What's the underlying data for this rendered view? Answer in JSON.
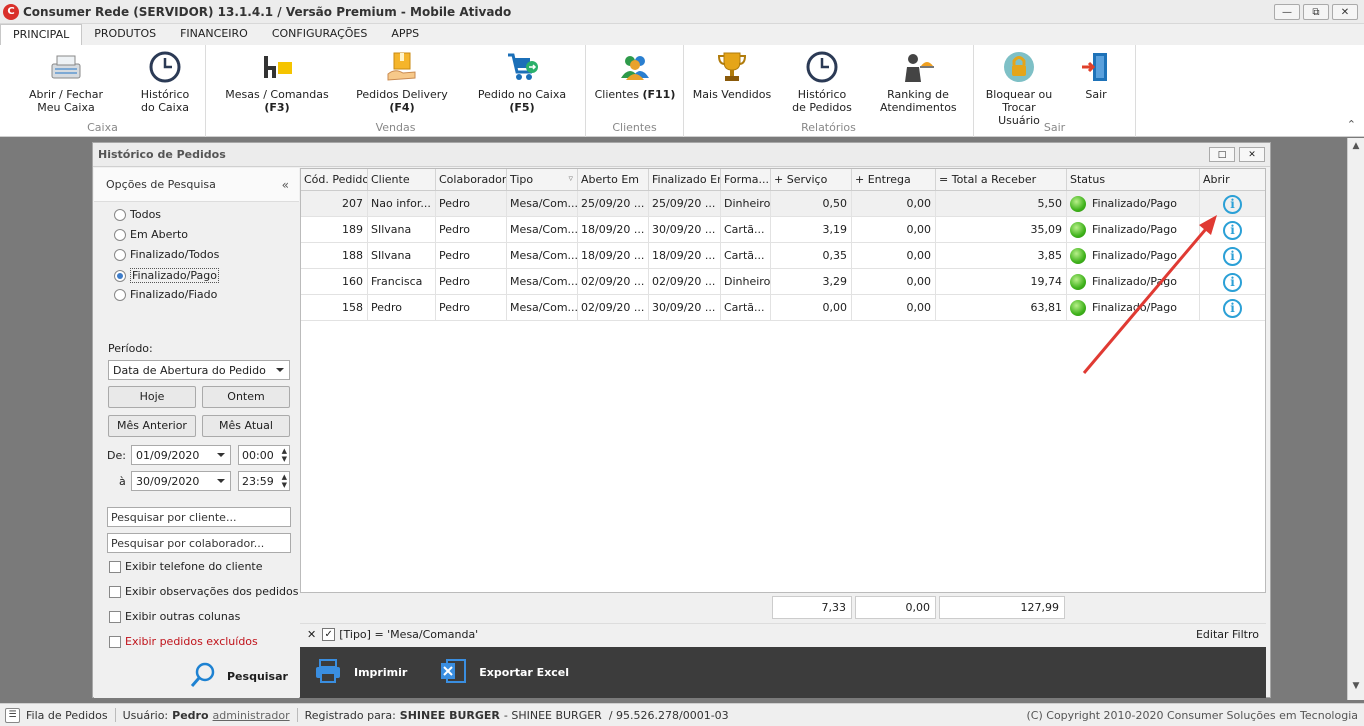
{
  "window": {
    "title": "Consumer Rede (SERVIDOR) 13.1.4.1 / Versão Premium - Mobile Ativado",
    "logo_icon": "consumer-logo-icon"
  },
  "menu_tabs": [
    "PRINCIPAL",
    "PRODUTOS",
    "FINANCEIRO",
    "CONFIGURAÇÕES",
    "APPS"
  ],
  "ribbon": {
    "groups": {
      "caixa": "Caixa",
      "vendas": "Vendas",
      "clientes": "Clientes",
      "relatorios": "Relatórios",
      "sair": "Sair"
    },
    "buttons": {
      "abrir_l1": "Abrir / Fechar",
      "abrir_l2": "Meu Caixa",
      "hist_caixa_l1": "Histórico",
      "hist_caixa_l2": "do Caixa",
      "mesas": "Mesas / Comandas",
      "mesas_key": "(F3)",
      "delivery": "Pedidos Delivery",
      "delivery_key": "(F4)",
      "pedido_caixa": "Pedido no Caixa",
      "pedido_caixa_key": "(F5)",
      "clientes": "Clientes",
      "clientes_key": "(F11)",
      "mais_vendidos": "Mais Vendidos",
      "hist_pedidos_l1": "Histórico",
      "hist_pedidos_l2": "de Pedidos",
      "ranking_l1": "Ranking de",
      "ranking_l2": "Atendimentos",
      "bloquear_l1": "Bloquear ou",
      "bloquear_l2": "Trocar Usuário",
      "sair": "Sair"
    }
  },
  "child_window": {
    "title": "Histórico de Pedidos"
  },
  "search_panel": {
    "header": "Opções de Pesquisa",
    "radios": [
      "Todos",
      "Em Aberto",
      "Finalizado/Todos",
      "Finalizado/Pago",
      "Finalizado/Fiado"
    ],
    "selected_radio": "Finalizado/Pago",
    "periodo_label": "Período:",
    "periodo_value": "Data de Abertura do Pedido",
    "btn_hoje": "Hoje",
    "btn_ontem": "Ontem",
    "btn_mes_anterior": "Mês Anterior",
    "btn_mes_atual": "Mês Atual",
    "de_label": "De:",
    "de_date": "01/09/2020",
    "de_time": "00:00",
    "a_label": "à",
    "a_date": "30/09/2020",
    "a_time": "23:59",
    "cliente_placeholder": "Pesquisar por cliente...",
    "colaborador_placeholder": "Pesquisar por colaborador...",
    "checks": [
      "Exibir telefone do cliente",
      "Exibir observações dos pedidos",
      "Exibir outras colunas",
      "Exibir pedidos excluídos"
    ],
    "search_label": "Pesquisar"
  },
  "grid": {
    "columns": [
      "Cód. Pedido",
      "Cliente",
      "Colaborador",
      "Tipo",
      "Aberto Em",
      "Finalizado Em",
      "Forma...",
      "+ Serviço",
      "+ Entrega",
      "= Total a Receber",
      "Status",
      "Abrir"
    ],
    "rows": [
      {
        "cod": "207",
        "cliente": "Nao infor...",
        "colab": "Pedro",
        "tipo": "Mesa/Com...",
        "aberto": "25/09/20 ...",
        "final": "25/09/20 ...",
        "forma": "Dinheiro",
        "servico": "0,50",
        "entrega": "0,00",
        "total": "5,50",
        "status": "Finalizado/Pago"
      },
      {
        "cod": "189",
        "cliente": "SIlvana",
        "colab": "Pedro",
        "tipo": "Mesa/Com...",
        "aberto": "18/09/20 ...",
        "final": "30/09/20 ...",
        "forma": "Cartã...",
        "servico": "3,19",
        "entrega": "0,00",
        "total": "35,09",
        "status": "Finalizado/Pago"
      },
      {
        "cod": "188",
        "cliente": "SIlvana",
        "colab": "Pedro",
        "tipo": "Mesa/Com...",
        "aberto": "18/09/20 ...",
        "final": "18/09/20 ...",
        "forma": "Cartã...",
        "servico": "0,35",
        "entrega": "0,00",
        "total": "3,85",
        "status": "Finalizado/Pago"
      },
      {
        "cod": "160",
        "cliente": "Francisca",
        "colab": "Pedro",
        "tipo": "Mesa/Com...",
        "aberto": "02/09/20 ...",
        "final": "02/09/20 ...",
        "forma": "Dinheiro",
        "servico": "3,29",
        "entrega": "0,00",
        "total": "19,74",
        "status": "Finalizado/Pago"
      },
      {
        "cod": "158",
        "cliente": "Pedro",
        "colab": "Pedro",
        "tipo": "Mesa/Com...",
        "aberto": "02/09/20 ...",
        "final": "30/09/20 ...",
        "forma": "Cartã...",
        "servico": "0,00",
        "entrega": "0,00",
        "total": "63,81",
        "status": "Finalizado/Pago"
      }
    ],
    "totals": {
      "servico": "7,33",
      "entrega": "0,00",
      "total": "127,99"
    },
    "filter_text": "[Tipo] = 'Mesa/Comanda'",
    "edit_filter": "Editar Filtro"
  },
  "actions": {
    "imprimir": "Imprimir",
    "exportar": "Exportar Excel"
  },
  "statusbar": {
    "fila": "Fila de Pedidos",
    "usuario_label": "Usuário:",
    "usuario": "Pedro",
    "perfil": "administrador",
    "registrado_label": "Registrado para:",
    "registrado": "SHINEE BURGER",
    "registrado_rest": "- SHINEE BURGER  / 95.526.278/0001-03",
    "copyright": "(C) Copyright 2010-2020 Consumer Soluções em Tecnologia"
  },
  "colors": {
    "accent_blue": "#2ba0d6",
    "status_green": "#3fb21b",
    "excluded_red": "#c0131b",
    "annotation_arrow": "#e03a33"
  }
}
